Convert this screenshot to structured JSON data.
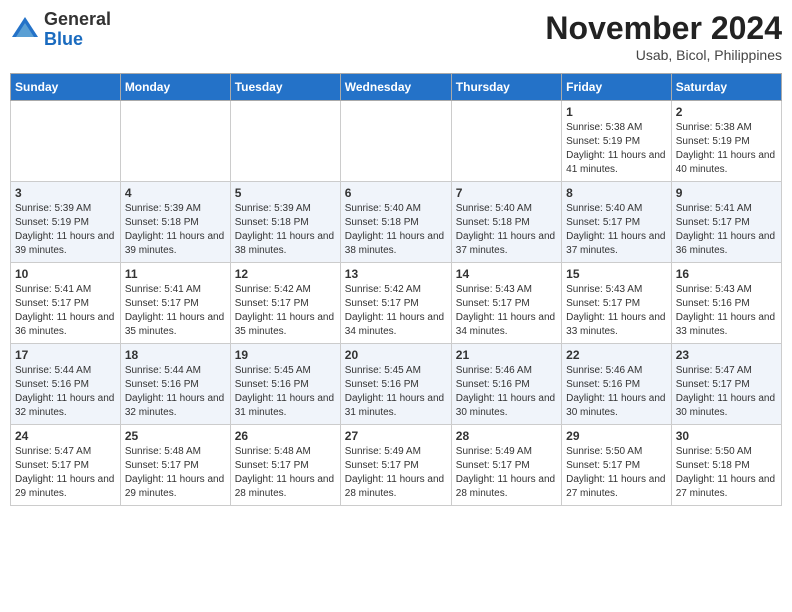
{
  "logo": {
    "general": "General",
    "blue": "Blue"
  },
  "title": {
    "month_year": "November 2024",
    "location": "Usab, Bicol, Philippines"
  },
  "days_of_week": [
    "Sunday",
    "Monday",
    "Tuesday",
    "Wednesday",
    "Thursday",
    "Friday",
    "Saturday"
  ],
  "weeks": [
    [
      {
        "day": "",
        "info": ""
      },
      {
        "day": "",
        "info": ""
      },
      {
        "day": "",
        "info": ""
      },
      {
        "day": "",
        "info": ""
      },
      {
        "day": "",
        "info": ""
      },
      {
        "day": "1",
        "info": "Sunrise: 5:38 AM\nSunset: 5:19 PM\nDaylight: 11 hours and 41 minutes."
      },
      {
        "day": "2",
        "info": "Sunrise: 5:38 AM\nSunset: 5:19 PM\nDaylight: 11 hours and 40 minutes."
      }
    ],
    [
      {
        "day": "3",
        "info": "Sunrise: 5:39 AM\nSunset: 5:19 PM\nDaylight: 11 hours and 39 minutes."
      },
      {
        "day": "4",
        "info": "Sunrise: 5:39 AM\nSunset: 5:18 PM\nDaylight: 11 hours and 39 minutes."
      },
      {
        "day": "5",
        "info": "Sunrise: 5:39 AM\nSunset: 5:18 PM\nDaylight: 11 hours and 38 minutes."
      },
      {
        "day": "6",
        "info": "Sunrise: 5:40 AM\nSunset: 5:18 PM\nDaylight: 11 hours and 38 minutes."
      },
      {
        "day": "7",
        "info": "Sunrise: 5:40 AM\nSunset: 5:18 PM\nDaylight: 11 hours and 37 minutes."
      },
      {
        "day": "8",
        "info": "Sunrise: 5:40 AM\nSunset: 5:17 PM\nDaylight: 11 hours and 37 minutes."
      },
      {
        "day": "9",
        "info": "Sunrise: 5:41 AM\nSunset: 5:17 PM\nDaylight: 11 hours and 36 minutes."
      }
    ],
    [
      {
        "day": "10",
        "info": "Sunrise: 5:41 AM\nSunset: 5:17 PM\nDaylight: 11 hours and 36 minutes."
      },
      {
        "day": "11",
        "info": "Sunrise: 5:41 AM\nSunset: 5:17 PM\nDaylight: 11 hours and 35 minutes."
      },
      {
        "day": "12",
        "info": "Sunrise: 5:42 AM\nSunset: 5:17 PM\nDaylight: 11 hours and 35 minutes."
      },
      {
        "day": "13",
        "info": "Sunrise: 5:42 AM\nSunset: 5:17 PM\nDaylight: 11 hours and 34 minutes."
      },
      {
        "day": "14",
        "info": "Sunrise: 5:43 AM\nSunset: 5:17 PM\nDaylight: 11 hours and 34 minutes."
      },
      {
        "day": "15",
        "info": "Sunrise: 5:43 AM\nSunset: 5:17 PM\nDaylight: 11 hours and 33 minutes."
      },
      {
        "day": "16",
        "info": "Sunrise: 5:43 AM\nSunset: 5:16 PM\nDaylight: 11 hours and 33 minutes."
      }
    ],
    [
      {
        "day": "17",
        "info": "Sunrise: 5:44 AM\nSunset: 5:16 PM\nDaylight: 11 hours and 32 minutes."
      },
      {
        "day": "18",
        "info": "Sunrise: 5:44 AM\nSunset: 5:16 PM\nDaylight: 11 hours and 32 minutes."
      },
      {
        "day": "19",
        "info": "Sunrise: 5:45 AM\nSunset: 5:16 PM\nDaylight: 11 hours and 31 minutes."
      },
      {
        "day": "20",
        "info": "Sunrise: 5:45 AM\nSunset: 5:16 PM\nDaylight: 11 hours and 31 minutes."
      },
      {
        "day": "21",
        "info": "Sunrise: 5:46 AM\nSunset: 5:16 PM\nDaylight: 11 hours and 30 minutes."
      },
      {
        "day": "22",
        "info": "Sunrise: 5:46 AM\nSunset: 5:16 PM\nDaylight: 11 hours and 30 minutes."
      },
      {
        "day": "23",
        "info": "Sunrise: 5:47 AM\nSunset: 5:17 PM\nDaylight: 11 hours and 30 minutes."
      }
    ],
    [
      {
        "day": "24",
        "info": "Sunrise: 5:47 AM\nSunset: 5:17 PM\nDaylight: 11 hours and 29 minutes."
      },
      {
        "day": "25",
        "info": "Sunrise: 5:48 AM\nSunset: 5:17 PM\nDaylight: 11 hours and 29 minutes."
      },
      {
        "day": "26",
        "info": "Sunrise: 5:48 AM\nSunset: 5:17 PM\nDaylight: 11 hours and 28 minutes."
      },
      {
        "day": "27",
        "info": "Sunrise: 5:49 AM\nSunset: 5:17 PM\nDaylight: 11 hours and 28 minutes."
      },
      {
        "day": "28",
        "info": "Sunrise: 5:49 AM\nSunset: 5:17 PM\nDaylight: 11 hours and 28 minutes."
      },
      {
        "day": "29",
        "info": "Sunrise: 5:50 AM\nSunset: 5:17 PM\nDaylight: 11 hours and 27 minutes."
      },
      {
        "day": "30",
        "info": "Sunrise: 5:50 AM\nSunset: 5:18 PM\nDaylight: 11 hours and 27 minutes."
      }
    ]
  ]
}
